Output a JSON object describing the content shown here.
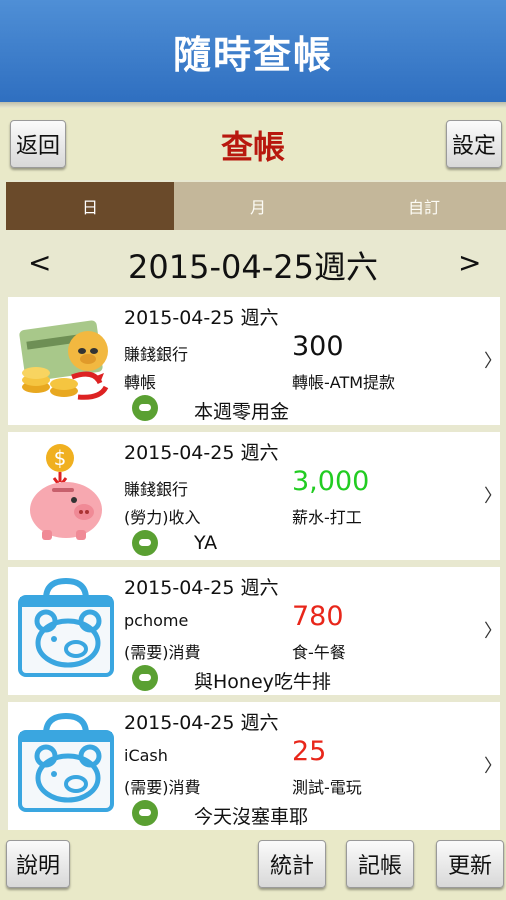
{
  "app": {
    "title": "隨時查帳"
  },
  "toolbar": {
    "back_label": "返回",
    "page_title": "查帳",
    "settings_label": "設定"
  },
  "tabs": [
    {
      "label": "日",
      "active": true
    },
    {
      "label": "月",
      "active": false
    },
    {
      "label": "自訂",
      "active": false
    }
  ],
  "date_nav": {
    "prev_label": "<",
    "date_label": "2015-04-25週六",
    "next_label": ">"
  },
  "records": [
    {
      "date": "2015-04-25 週六",
      "account": "賺錢銀行",
      "amount": "300",
      "amount_color": "#111111",
      "type": "轉帳",
      "category": "轉帳-ATM提款",
      "note": "本週零用金",
      "icon": "transfer-coins-icon"
    },
    {
      "date": "2015-04-25 週六",
      "account": "賺錢銀行",
      "amount": "3,000",
      "amount_color": "#22cc22",
      "type": "(勞力)收入",
      "category": "薪水-打工",
      "note": "YA",
      "icon": "piggy-bank-icon"
    },
    {
      "date": "2015-04-25 週六",
      "account": "pchome",
      "amount": "780",
      "amount_color": "#e8261a",
      "type": "(需要)消費",
      "category": "食-午餐",
      "note": "與Honey吃牛排",
      "icon": "shopping-bag-icon"
    },
    {
      "date": "2015-04-25 週六",
      "account": "iCash",
      "amount": "25",
      "amount_color": "#e8261a",
      "type": "(需要)消費",
      "category": "測試-電玩",
      "note": "今天沒塞車耶",
      "icon": "shopping-bag-icon"
    }
  ],
  "record_chevron": "〉",
  "bottom_bar": {
    "help_label": "說明",
    "stats_label": "統計",
    "record_label": "記帳",
    "update_label": "更新"
  }
}
